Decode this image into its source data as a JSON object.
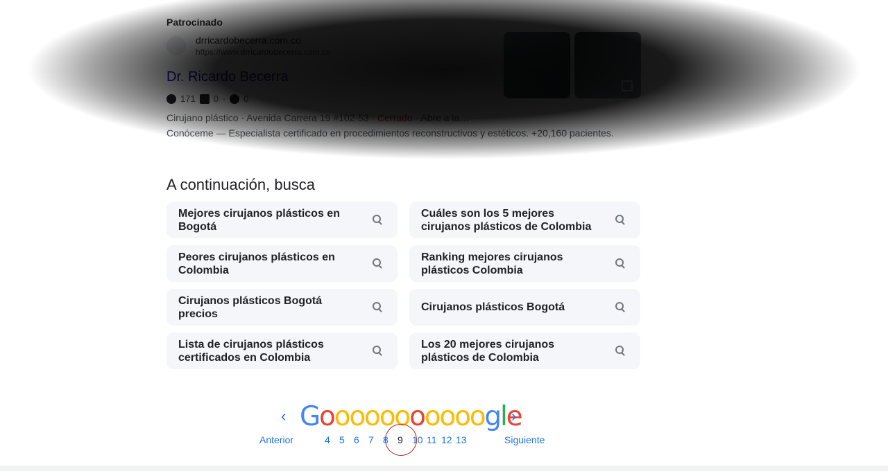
{
  "sponsored": {
    "label": "Patrocinado",
    "site_name": "drricardobecerra.com.co",
    "site_url": "https://www.drricardobecerra.com.co",
    "title": "Dr. Ricardo Becerra",
    "stats": [
      "171",
      "0",
      "0"
    ],
    "desc_prefix": "Cirujano plástico · Avenida Carrera 19 #102-53 · ",
    "desc_status": "Cerrado",
    "desc_suffix": " · Abre a la…",
    "desc2": "Conóceme — Especialista certificado en procedimientos reconstructivos y estéticos. +20,160 pacientes."
  },
  "related": {
    "title": "A continuación, busca",
    "items": [
      "Mejores cirujanos plásticos en Bogotá",
      "Cuáles son los 5 mejores cirujanos plásticos de Colombia",
      "Peores cirujanos plásticos en Colombia",
      "Ranking mejores cirujanos plásticos Colombia",
      "Cirujanos plásticos Bogotá precios",
      "Cirujanos plásticos Bogotá",
      "Lista de cirujanos plásticos certificados en Colombia",
      "Los 20 mejores cirujanos plásticos de Colombia"
    ]
  },
  "pager": {
    "prev": "Anterior",
    "next": "Siguiente",
    "prev_arrow": "‹",
    "next_arrow": "›",
    "logo": [
      "G",
      "o",
      "o",
      "o",
      "o",
      "o",
      "o",
      "o",
      "o",
      "o",
      "o",
      "o",
      "g",
      "l",
      "e"
    ],
    "pages": [
      "4",
      "5",
      "6",
      "7",
      "8",
      "9",
      "10",
      "11",
      "12",
      "13"
    ],
    "current": "9"
  },
  "colors": {
    "link": "#1a73e8",
    "closed": "#d93025",
    "annotation_circle": "#b3261e",
    "chip_bg": "#f5f6f9"
  }
}
